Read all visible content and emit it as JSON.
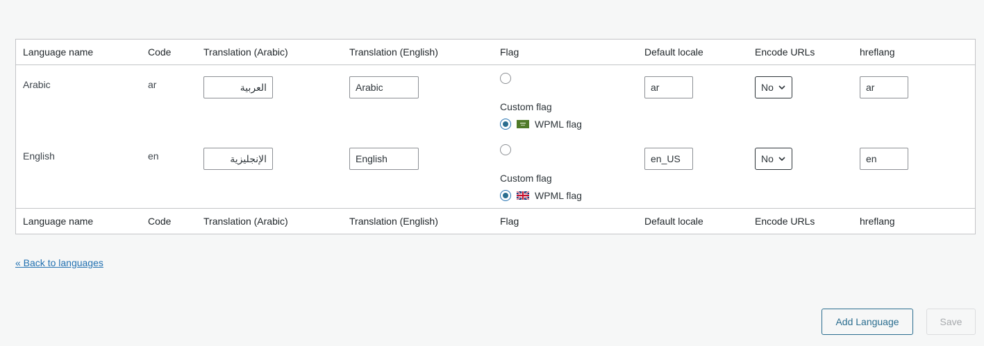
{
  "columns": [
    "Language name",
    "Code",
    "Translation (Arabic)",
    "Translation (English)",
    "Flag",
    "Default locale",
    "Encode URLs",
    "hreflang"
  ],
  "rows": [
    {
      "name": "Arabic",
      "code": "ar",
      "translation_arabic": "العربية",
      "translation_english": "Arabic",
      "custom_flag_label": "Custom flag",
      "wpml_flag_label": "WPML flag",
      "flag_icon": "saudi-arabia-flag-icon",
      "default_locale": "ar",
      "encode_urls": "No",
      "hreflang": "ar"
    },
    {
      "name": "English",
      "code": "en",
      "translation_arabic": "الإنجليزية",
      "translation_english": "English",
      "custom_flag_label": "Custom flag",
      "wpml_flag_label": "WPML flag",
      "flag_icon": "uk-flag-icon",
      "default_locale": "en_US",
      "encode_urls": "No",
      "hreflang": "en"
    }
  ],
  "back_link": "« Back to languages",
  "buttons": {
    "add_language": "Add Language",
    "save": "Save"
  },
  "colors": {
    "accent": "#2a6d8f",
    "link": "#2271b1",
    "border": "#c3c4c7",
    "background": "#f6f7f7"
  }
}
